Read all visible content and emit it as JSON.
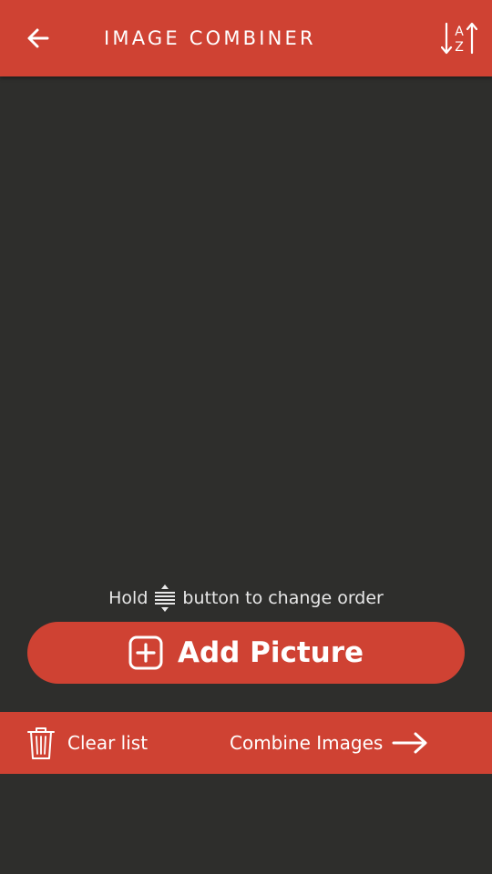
{
  "colors": {
    "accent": "#cf4233",
    "background": "#2e2e2c",
    "text_light": "#e8e8e8",
    "icon": "#ffffff"
  },
  "app_bar": {
    "title": "IMAGE COMBINER",
    "back_icon": "arrow-left-icon",
    "sort_icon": "sort-az-icon",
    "sort_glyph_a": "A",
    "sort_glyph_z": "Z"
  },
  "hint": {
    "prefix": "Hold",
    "suffix": "button to change order",
    "icon": "drag-handle-icon"
  },
  "add_button": {
    "label": "Add Picture",
    "icon": "plus-square-icon"
  },
  "bottom_bar": {
    "clear_label": "Clear list",
    "clear_icon": "trash-icon",
    "combine_label": "Combine Images",
    "combine_icon": "arrow-right-icon"
  }
}
